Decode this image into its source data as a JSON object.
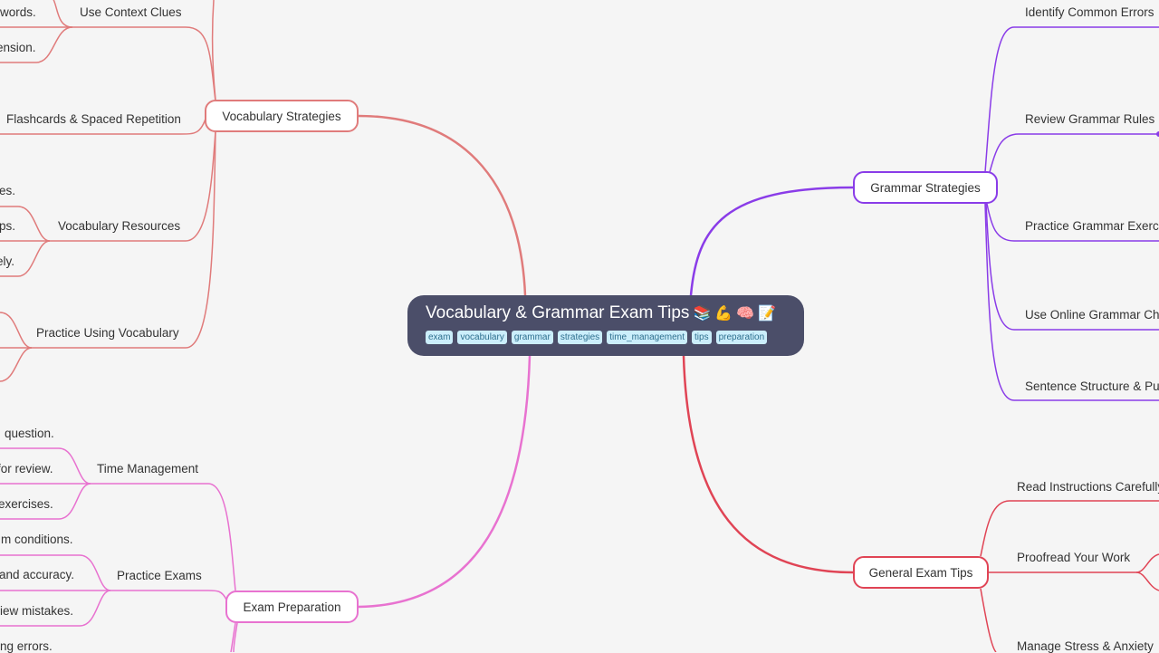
{
  "colors": {
    "background": "#f5f5f5",
    "root": "#4b4e69",
    "vocabulary_branch": "#e07b7b",
    "exam_branch": "#e872d0",
    "grammar_branch": "#8a3ce8",
    "general_branch": "#e04455",
    "tag_bg": "#cbeefb",
    "tag_text": "#2d6f8e"
  },
  "root": {
    "title": "Vocabulary & Grammar Exam Tips",
    "emojis": [
      "📚",
      "💪",
      "🧠",
      "📝"
    ],
    "tags": [
      "exam",
      "vocabulary",
      "grammar",
      "strategies",
      "time_management",
      "tips",
      "preparation"
    ]
  },
  "branches": {
    "vocabulary": {
      "label": "Vocabulary Strategies",
      "children": [
        {
          "label": "Use Context Clues",
          "leaves": [
            "words.",
            "ension."
          ]
        },
        {
          "label": "Flashcards & Spaced Repetition",
          "leaves": []
        },
        {
          "label": "Vocabulary Resources",
          "leaves": [
            "es.",
            "ps.",
            "ely."
          ]
        },
        {
          "label": "Practice Using Vocabulary",
          "leaves": []
        }
      ]
    },
    "exam": {
      "label": "Exam Preparation",
      "children": [
        {
          "label": "Time Management",
          "leaves": [
            "question.",
            "for review.",
            "exercises."
          ]
        },
        {
          "label": "Practice Exams",
          "leaves": [
            "m conditions.",
            "and accuracy.",
            "iew mistakes.",
            "ing errors."
          ]
        }
      ]
    },
    "grammar": {
      "label": "Grammar Strategies",
      "children": [
        {
          "label": "Identify Common Errors"
        },
        {
          "label": "Review Grammar Rules"
        },
        {
          "label": "Practice Grammar Exercis"
        },
        {
          "label": "Use Online Grammar Che"
        },
        {
          "label": "Sentence Structure & Pu"
        }
      ]
    },
    "general": {
      "label": "General Exam Tips",
      "children": [
        {
          "label": "Read Instructions Carefully"
        },
        {
          "label": "Proofread Your Work"
        },
        {
          "label": "Manage Stress & Anxiety"
        }
      ]
    }
  }
}
